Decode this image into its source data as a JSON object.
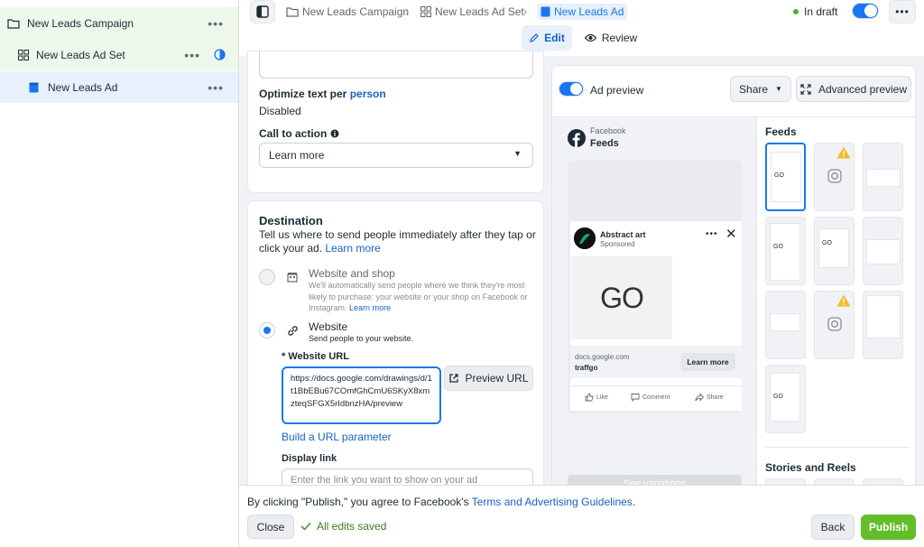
{
  "nav": {
    "campaign": "New Leads Campaign",
    "adset": "New Leads Ad Set",
    "ad": "New Leads Ad",
    "more": "•••"
  },
  "breadcrumb": {
    "campaign": "New Leads Campaign",
    "adset": "New Leads Ad Set",
    "ad": "New Leads Ad"
  },
  "status": {
    "label": "In draft",
    "color": "#42b72a"
  },
  "tabs": {
    "edit": "Edit",
    "review": "Review"
  },
  "optimize": {
    "title_prefix": "Optimize text per ",
    "title_link": "person",
    "value": "Disabled"
  },
  "cta": {
    "label": "Call to action",
    "selected": "Learn more"
  },
  "destination": {
    "title": "Destination",
    "desc": "Tell us where to send people immediately after they tap or click your ad.",
    "learn_more": "Learn more",
    "option1": {
      "title": "Website and shop",
      "desc": "We'll automatically send people where we think they're most likely to purchase: your website or your shop on Facebook or Instagram.",
      "learn_more": "Learn more"
    },
    "option2": {
      "title": "Website",
      "desc": "Send people to your website."
    },
    "url_label": "* Website URL",
    "url_value": "https://docs.google.com/drawings/d/1t1BbEBu67COmfGhCmU6SKyX8xmzteqSFGX5rIdbnzHA/preview",
    "preview_url": "Preview URL",
    "build_param": "Build a URL parameter",
    "display_link_label": "Display link",
    "display_link_placeholder": "Enter the link you want to show on your ad"
  },
  "preview": {
    "toggle_label": "Ad preview",
    "share": "Share",
    "advanced": "Advanced preview",
    "platform": "Facebook",
    "placement": "Feeds",
    "page_name": "Abstract art",
    "sponsored": "Sponsored",
    "creative_text": "GO",
    "link_domain": "docs.google.com",
    "link_title": "traffgo",
    "cta": "Learn more",
    "like": "Like",
    "comment": "Comment",
    "share_action": "Share",
    "see_variations": "See variations",
    "feeds_heading": "Feeds",
    "stories_heading": "Stories and Reels"
  },
  "footer": {
    "notice_prefix": "By clicking \"Publish,\" you agree to Facebook's ",
    "notice_link": "Terms and Advertising Guidelines",
    "notice_suffix": ".",
    "close": "Close",
    "saved": "All edits saved",
    "back": "Back",
    "publish": "Publish"
  },
  "colors": {
    "accent": "#1877f2",
    "publish": "#67c23a",
    "nav_selected": "#e7f0fb",
    "nav_campaign": "#eef8ea"
  }
}
